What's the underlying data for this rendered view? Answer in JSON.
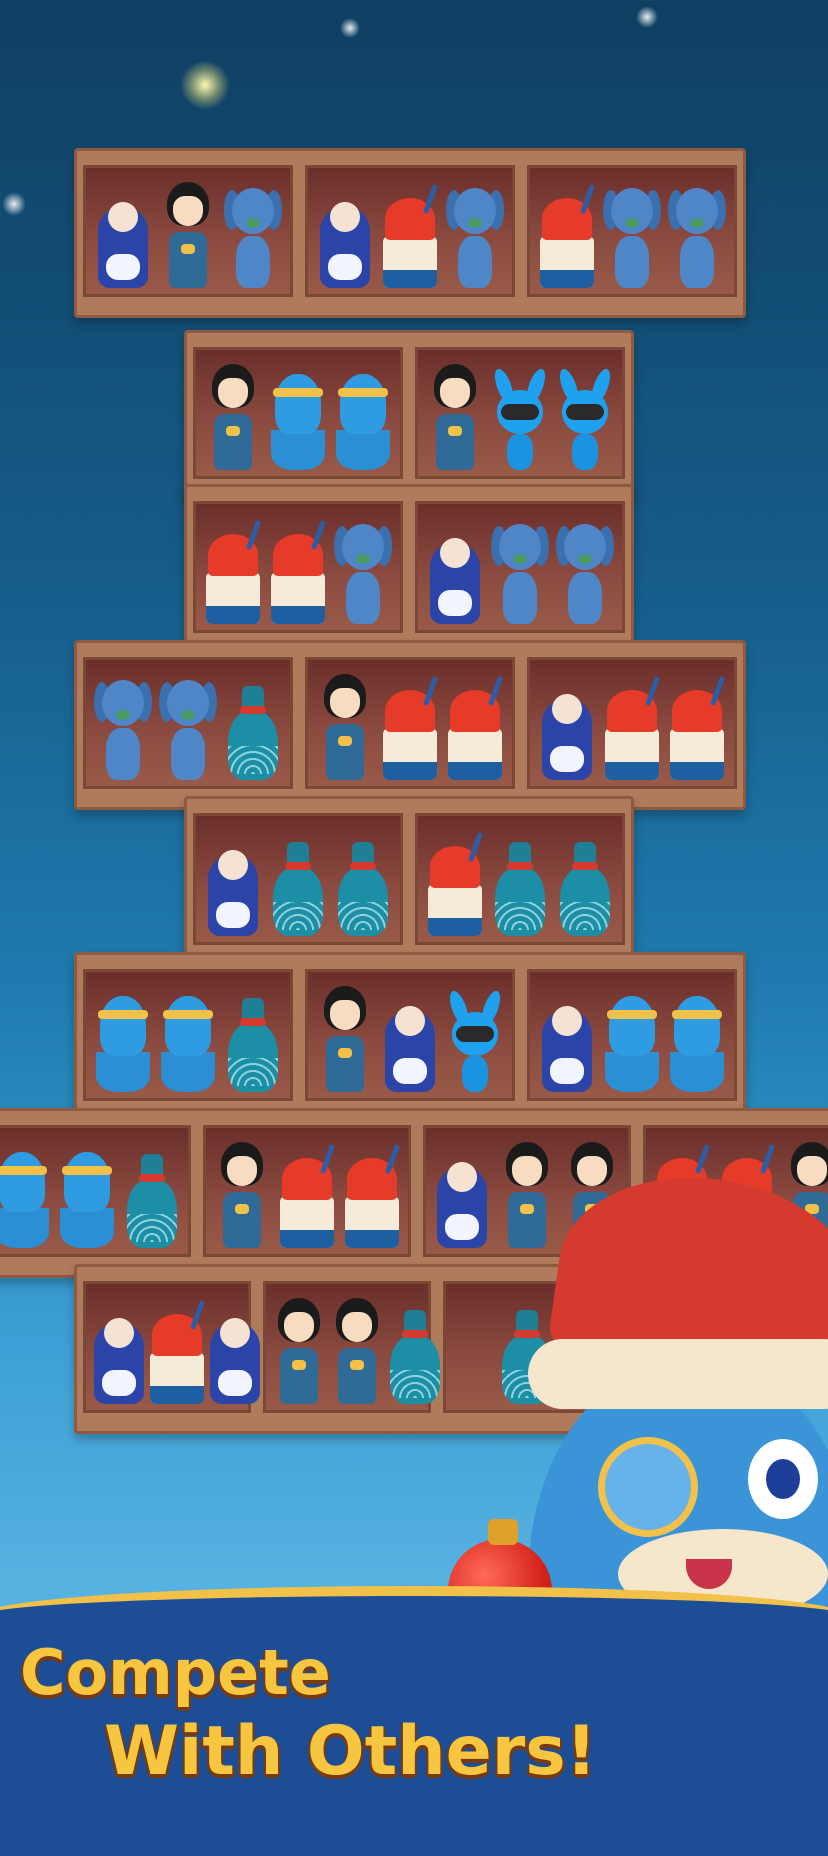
{
  "tagline": {
    "line1": "Compete",
    "line2": "With Others!"
  },
  "colors": {
    "shelf_wood": "#b07b5d",
    "cell_interior": "#7a3a33",
    "headline_gold": "#f7c640",
    "banner_blue": "#1d4e95"
  },
  "item_types": [
    "matryoshka-doll",
    "kokeshi-doll",
    "blue-dog",
    "shave-ice",
    "octopus",
    "blue-bunny",
    "blue-vase"
  ],
  "shelves": [
    {
      "row": 1,
      "cells": [
        [
          "doll",
          "koke",
          "dog"
        ],
        [
          "doll",
          "ice",
          "dog"
        ],
        [
          "ice",
          "dog",
          "dog"
        ]
      ]
    },
    {
      "row": 2,
      "cells": [
        [
          "koke",
          "octo",
          "octo"
        ],
        [
          "koke",
          "bun",
          "bun"
        ]
      ]
    },
    {
      "row": 3,
      "cells": [
        [
          "ice",
          "ice",
          "dog"
        ],
        [
          "doll",
          "dog",
          "dog"
        ]
      ]
    },
    {
      "row": 4,
      "cells": [
        [
          "dog",
          "dog",
          "vase"
        ],
        [
          "koke",
          "ice",
          "ice"
        ],
        [
          "doll",
          "ice",
          "ice"
        ]
      ]
    },
    {
      "row": 5,
      "cells": [
        [
          "doll",
          "vase",
          "vase"
        ],
        [
          "ice",
          "vase",
          "vase"
        ]
      ]
    },
    {
      "row": 6,
      "cells": [
        [
          "octo",
          "octo",
          "vase"
        ],
        [
          "koke",
          "doll",
          "bun"
        ],
        [
          "doll",
          "octo",
          "octo"
        ]
      ]
    },
    {
      "row": 7,
      "cells": [
        [
          "octo",
          "octo",
          "vase"
        ],
        [
          "koke",
          "ice",
          "ice"
        ],
        [
          "doll",
          "koke",
          "koke"
        ],
        [
          "ice",
          "ice",
          "koke"
        ]
      ]
    },
    {
      "row": 8,
      "cells": [
        [
          "doll",
          "ice",
          "doll"
        ],
        [
          "koke",
          "koke",
          "vase"
        ],
        [
          "vase"
        ]
      ]
    }
  ]
}
